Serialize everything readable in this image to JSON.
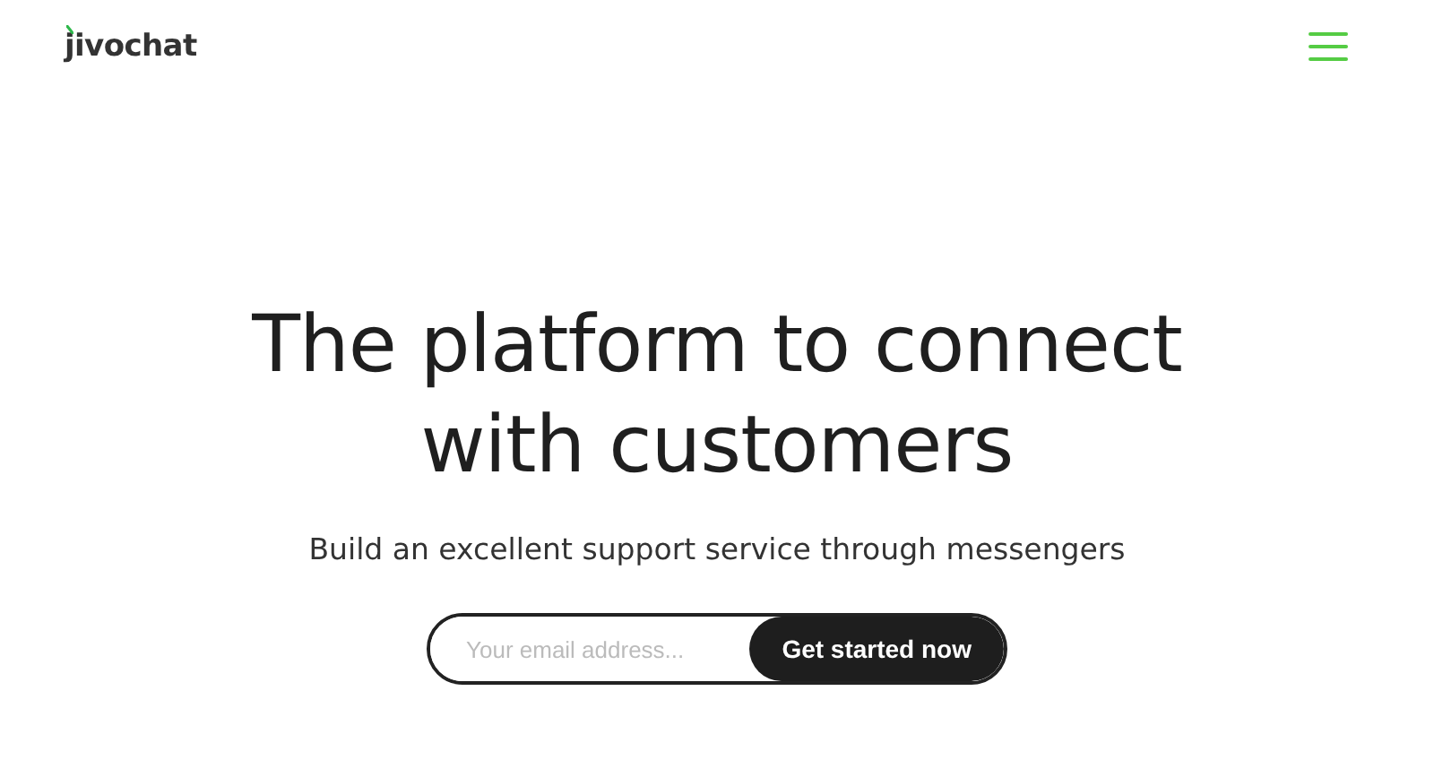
{
  "header": {
    "logo": "jivochat"
  },
  "hero": {
    "title": "The platform to connect with customers",
    "subtitle": "Build an excellent support service through messengers"
  },
  "signup": {
    "placeholder": "Your email address...",
    "button": "Get started now"
  }
}
